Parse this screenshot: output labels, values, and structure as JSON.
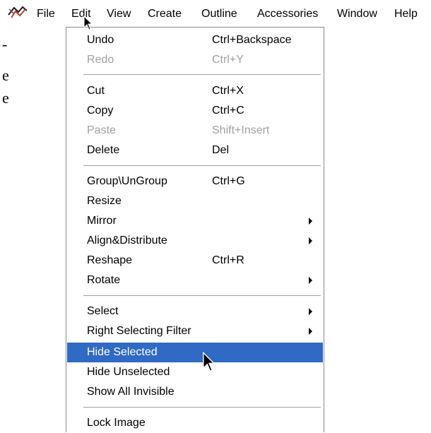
{
  "menubar": {
    "items": [
      {
        "label": "File"
      },
      {
        "label": "Edit"
      },
      {
        "label": "View"
      },
      {
        "label": "Create"
      },
      {
        "label": "Outline"
      },
      {
        "label": "Accessories"
      },
      {
        "label": "Window"
      },
      {
        "label": "Help"
      }
    ]
  },
  "background": {
    "glyph1": "-",
    "glyph2": "e",
    "glyph3": "e"
  },
  "edit_menu": {
    "items": [
      {
        "label": "Undo",
        "shortcut": "Ctrl+Backspace"
      },
      {
        "label": "Redo",
        "shortcut": "Ctrl+Y"
      },
      {
        "label": "Cut",
        "shortcut": "Ctrl+X"
      },
      {
        "label": "Copy",
        "shortcut": "Ctrl+C"
      },
      {
        "label": "Paste",
        "shortcut": "Shift+Insert"
      },
      {
        "label": "Delete",
        "shortcut": "Del"
      },
      {
        "label": "Group\\UnGroup",
        "shortcut": "Ctrl+G"
      },
      {
        "label": "Resize",
        "shortcut": ""
      },
      {
        "label": "Mirror",
        "shortcut": ""
      },
      {
        "label": "Align&Distribute",
        "shortcut": ""
      },
      {
        "label": "Reshape",
        "shortcut": "Ctrl+R"
      },
      {
        "label": "Rotate",
        "shortcut": ""
      },
      {
        "label": "Select",
        "shortcut": ""
      },
      {
        "label": "Right Selecting Filter",
        "shortcut": ""
      },
      {
        "label": "Hide Selected",
        "shortcut": ""
      },
      {
        "label": "Hide Unselected",
        "shortcut": ""
      },
      {
        "label": "Show All Invisible",
        "shortcut": ""
      },
      {
        "label": "Lock Image",
        "shortcut": ""
      }
    ]
  },
  "colors": {
    "highlight": "#316ac5",
    "disabled_text": "#a0a0a0"
  }
}
